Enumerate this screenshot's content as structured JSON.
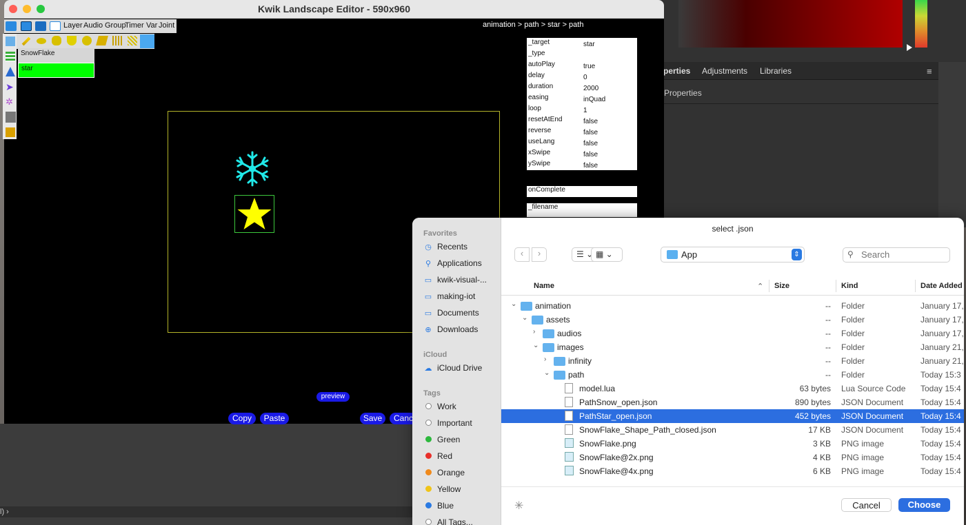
{
  "editor": {
    "title": "Kwik Landscape Editor - 590x960",
    "menu": [
      "Layer",
      "Audio",
      "Group",
      "Timer",
      "Var",
      "Joint"
    ],
    "layers": [
      "SnowFlake",
      "star"
    ],
    "breadcrumb": "animation > path > star > path",
    "properties": [
      {
        "key": "_target",
        "value": "star"
      },
      {
        "key": "_type",
        "value": ""
      },
      {
        "key": "autoPlay",
        "value": "true"
      },
      {
        "key": "delay",
        "value": "0"
      },
      {
        "key": "duration",
        "value": "2000"
      },
      {
        "key": "easing",
        "value": "inQuad"
      },
      {
        "key": "loop",
        "value": "1"
      },
      {
        "key": "resetAtEnd",
        "value": "false"
      },
      {
        "key": "reverse",
        "value": "false"
      },
      {
        "key": "useLang",
        "value": "false"
      },
      {
        "key": "xSwipe",
        "value": "false"
      },
      {
        "key": "ySwipe",
        "value": "false"
      }
    ],
    "on_complete": "onComplete",
    "filename_label": "_filename",
    "buttons": {
      "preview": "preview",
      "copy": "Copy",
      "paste": "Paste",
      "save": "Save",
      "cancel": "Canc"
    }
  },
  "ps_panel": {
    "tabs": [
      "perties",
      "Adjustments",
      "Libraries"
    ],
    "sub": "Properties",
    "menu_icon": "≡"
  },
  "bottom_strip": "l)   ›",
  "dialog": {
    "title": "select .json",
    "location": "App",
    "search_placeholder": "Search",
    "sidebar": {
      "favorites_head": "Favorites",
      "favorites": [
        {
          "icon": "clock-icon",
          "glyph": "◷",
          "label": "Recents"
        },
        {
          "icon": "applications-icon",
          "glyph": "⚲",
          "label": "Applications"
        },
        {
          "icon": "folder-icon",
          "glyph": "▭",
          "label": "kwik-visual-..."
        },
        {
          "icon": "folder-icon",
          "glyph": "▭",
          "label": "making-iot"
        },
        {
          "icon": "document-icon",
          "glyph": "▭",
          "label": "Documents"
        },
        {
          "icon": "download-icon",
          "glyph": "⊕",
          "label": "Downloads"
        }
      ],
      "icloud_head": "iCloud",
      "icloud": [
        {
          "icon": "cloud-icon",
          "glyph": "☁",
          "label": "iCloud Drive"
        }
      ],
      "tags_head": "Tags",
      "tags": [
        {
          "label": "Work",
          "color": "#ffffff"
        },
        {
          "label": "Important",
          "color": "#ffffff"
        },
        {
          "label": "Green",
          "color": "#2db83d"
        },
        {
          "label": "Red",
          "color": "#e8302b"
        },
        {
          "label": "Orange",
          "color": "#f08a1c"
        },
        {
          "label": "Yellow",
          "color": "#f0c419"
        },
        {
          "label": "Blue",
          "color": "#2a7ae2"
        },
        {
          "label": "All Tags...",
          "color": "#ffffff"
        }
      ]
    },
    "columns": {
      "name": "Name",
      "size": "Size",
      "kind": "Kind",
      "date": "Date Added"
    },
    "files": [
      {
        "indent": 0,
        "disc": "⌄",
        "type": "folder",
        "name": "animation",
        "size": "--",
        "kind": "Folder",
        "date": "January 17,"
      },
      {
        "indent": 1,
        "disc": "⌄",
        "type": "folder",
        "name": "assets",
        "size": "--",
        "kind": "Folder",
        "date": "January 17,"
      },
      {
        "indent": 2,
        "disc": "›",
        "type": "folder",
        "name": "audios",
        "size": "--",
        "kind": "Folder",
        "date": "January 17,"
      },
      {
        "indent": 2,
        "disc": "⌄",
        "type": "folder",
        "name": "images",
        "size": "--",
        "kind": "Folder",
        "date": "January 21,"
      },
      {
        "indent": 3,
        "disc": "›",
        "type": "folder",
        "name": "infinity",
        "size": "--",
        "kind": "Folder",
        "date": "January 21,"
      },
      {
        "indent": 3,
        "disc": "⌄",
        "type": "folder",
        "name": "path",
        "size": "--",
        "kind": "Folder",
        "date": "Today 15:3"
      },
      {
        "indent": 4,
        "disc": "",
        "type": "file",
        "name": "model.lua",
        "size": "63 bytes",
        "kind": "Lua Source Code",
        "date": "Today 15:4"
      },
      {
        "indent": 4,
        "disc": "",
        "type": "file",
        "name": "PathSnow_open.json",
        "size": "890 bytes",
        "kind": "JSON Document",
        "date": "Today 15:4"
      },
      {
        "indent": 4,
        "disc": "",
        "type": "file",
        "name": "PathStar_open.json",
        "size": "452 bytes",
        "kind": "JSON Document",
        "date": "Today 15:4",
        "selected": true
      },
      {
        "indent": 4,
        "disc": "",
        "type": "file",
        "name": "SnowFlake_Shape_Path_closed.json",
        "size": "17 KB",
        "kind": "JSON Document",
        "date": "Today 15:4"
      },
      {
        "indent": 4,
        "disc": "",
        "type": "png",
        "name": "SnowFlake.png",
        "size": "3 KB",
        "kind": "PNG image",
        "date": "Today 15:4"
      },
      {
        "indent": 4,
        "disc": "",
        "type": "png",
        "name": "SnowFlake@2x.png",
        "size": "4 KB",
        "kind": "PNG image",
        "date": "Today 15:4"
      },
      {
        "indent": 4,
        "disc": "",
        "type": "png",
        "name": "SnowFlake@4x.png",
        "size": "6 KB",
        "kind": "PNG image",
        "date": "Today 15:4"
      }
    ],
    "cancel": "Cancel",
    "choose": "Choose"
  }
}
